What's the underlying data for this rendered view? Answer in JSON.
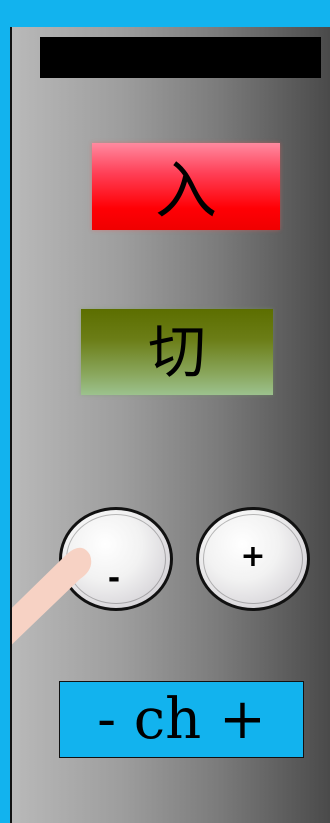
{
  "remote": {
    "power_on_label": "入",
    "power_off_label": "切",
    "minus_label": "-",
    "plus_label": "+",
    "channel_label": "- ch +"
  },
  "colors": {
    "frame_blue": "#12b3ee",
    "on_red": "#ff0005",
    "off_olive": "#6b7d16"
  },
  "icons": {
    "finger": "pointing-hand-icon"
  }
}
